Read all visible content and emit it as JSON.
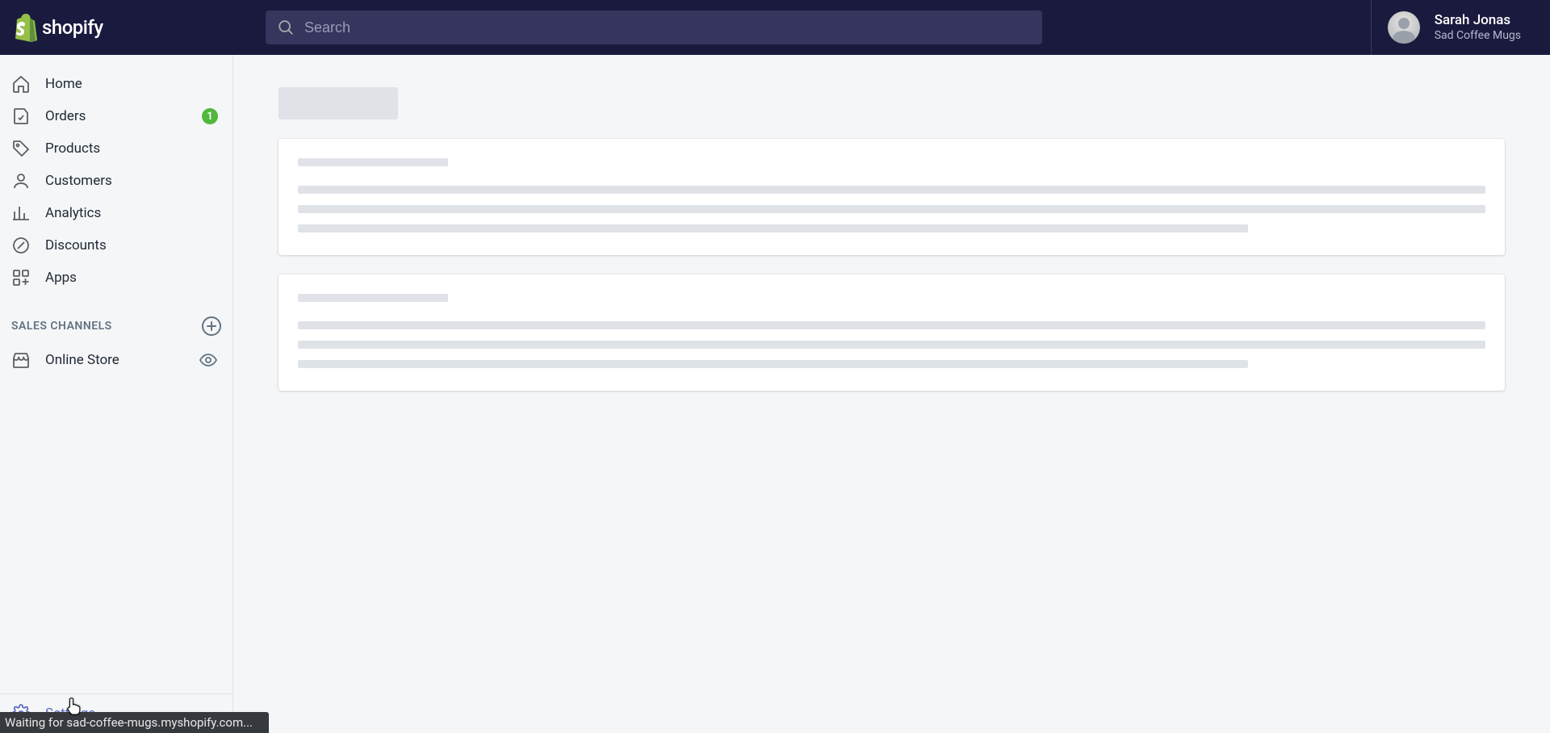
{
  "brand": {
    "name": "shopify"
  },
  "search": {
    "placeholder": "Search"
  },
  "user": {
    "name": "Sarah Jonas",
    "store": "Sad Coffee Mugs"
  },
  "nav": {
    "home": "Home",
    "orders": "Orders",
    "orders_badge": "1",
    "products": "Products",
    "customers": "Customers",
    "analytics": "Analytics",
    "discounts": "Discounts",
    "apps": "Apps"
  },
  "sales_channels": {
    "title": "SALES CHANNELS",
    "online_store": "Online Store"
  },
  "settings": {
    "label": "Settings"
  },
  "status": {
    "text": "Waiting for sad-coffee-mugs.myshopify.com..."
  },
  "colors": {
    "topbar": "#1a1a3e",
    "accent": "#00a39b",
    "badge": "#50b83c",
    "link": "#5c6ac4"
  }
}
